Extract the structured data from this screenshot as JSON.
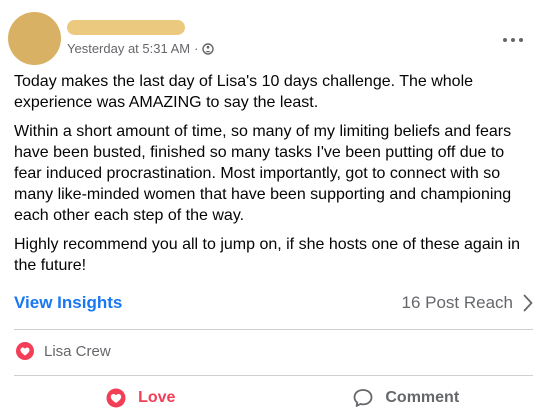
{
  "post": {
    "timestamp": "Yesterday at 5:31 AM",
    "separator": "·",
    "privacy_icon": "globe-icon",
    "more_icon": "more-options-icon",
    "paragraphs": [
      "Today makes the last day of Lisa's 10 days challenge. The whole experience was AMAZING to say the least.",
      "Within a short amount of time, so many of my limiting beliefs and fears have been busted, finished so many tasks I've been putting off due to fear induced procrastination. Most importantly, got to connect with so many like-minded women that have been supporting and championing each other each step of the way.",
      "Highly recommend you all to jump on, if she hosts one of these again in the future!"
    ]
  },
  "insights": {
    "link_label": "View Insights",
    "reach_label": "16 Post Reach",
    "chevron_icon": "chevron-right-icon"
  },
  "reactions": {
    "icon": "heart-reaction-icon",
    "label": "Lisa Crew"
  },
  "actions": {
    "love_label": "Love",
    "comment_label": "Comment"
  },
  "colors": {
    "accent": "#1877f2",
    "love": "#f33e58",
    "muted": "#65676b",
    "avatar": "#d9b165"
  }
}
